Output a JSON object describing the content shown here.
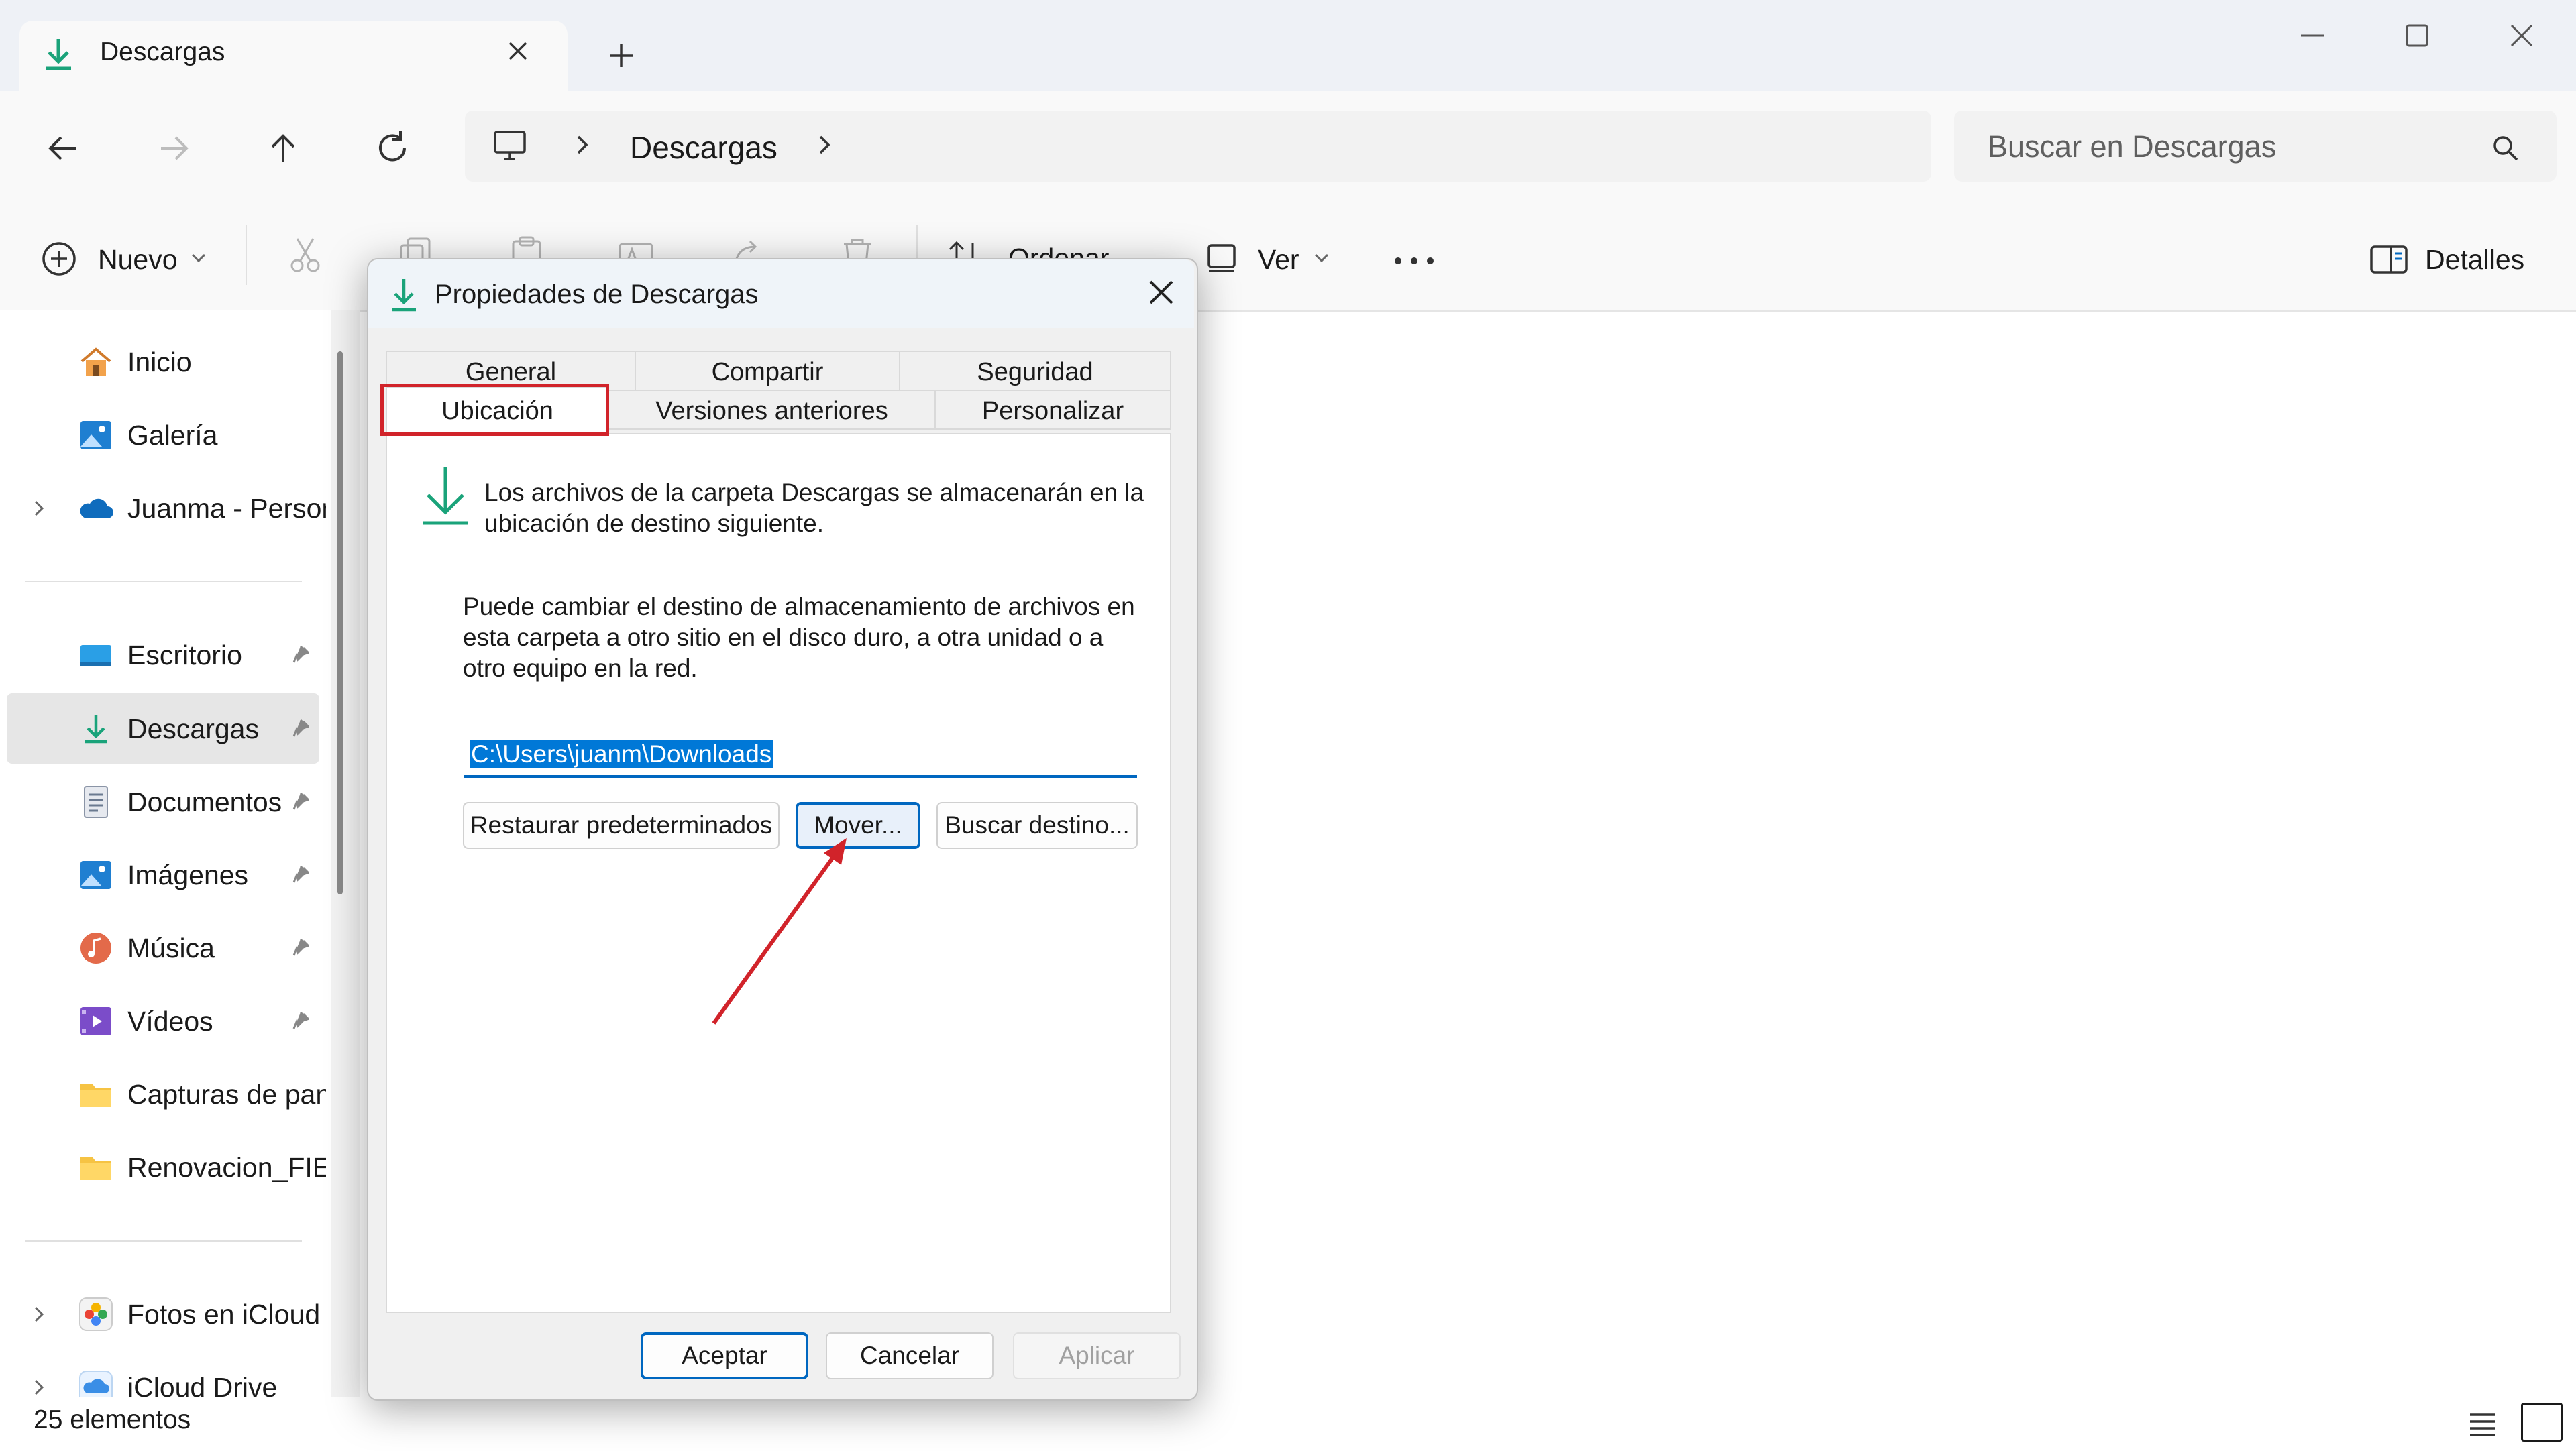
{
  "window": {
    "tab_title": "Descargas",
    "new_tab": "+"
  },
  "address": {
    "location": "Descargas",
    "search_placeholder": "Buscar en Descargas"
  },
  "commandbar": {
    "new_label": "Nuevo",
    "sort_label": "Ordenar",
    "view_label": "Ver",
    "details_label": "Detalles"
  },
  "nav": {
    "items": [
      {
        "label": "Inicio",
        "icon": "home-icon"
      },
      {
        "label": "Galería",
        "icon": "gallery-icon"
      },
      {
        "label": "Juanma - Personal",
        "icon": "onedrive-cloud-icon"
      },
      {
        "label": "Escritorio",
        "icon": "desktop-folder-icon"
      },
      {
        "label": "Descargas",
        "icon": "downloads-icon"
      },
      {
        "label": "Documentos",
        "icon": "documents-icon"
      },
      {
        "label": "Imágenes",
        "icon": "pictures-icon"
      },
      {
        "label": "Música",
        "icon": "music-icon"
      },
      {
        "label": "Vídeos",
        "icon": "videos-icon"
      },
      {
        "label": "Capturas de pantalla",
        "icon": "folder-icon"
      },
      {
        "label": "Renovacion_FIEL",
        "icon": "folder-icon"
      },
      {
        "label": "Fotos en iCloud",
        "icon": "icloud-photos-icon"
      },
      {
        "label": "iCloud Drive",
        "icon": "icloud-drive-icon"
      }
    ]
  },
  "status": {
    "count": "25 elementos"
  },
  "dialog": {
    "title": "Propiedades de Descargas",
    "tabs": {
      "general": "General",
      "compartir": "Compartir",
      "seguridad": "Seguridad",
      "ubicacion": "Ubicación",
      "versiones": "Versiones anteriores",
      "personalizar": "Personalizar"
    },
    "intro": "Los archivos de la carpeta Descargas se almacenarán en la ubicación de destino siguiente.",
    "description": "Puede cambiar el destino de almacenamiento de archivos en esta carpeta a otro sitio en el disco duro, a otra unidad o a otro equipo en la red.",
    "path": "C:\\Users\\juanm\\Downloads",
    "buttons": {
      "restore": "Restaurar predeterminados",
      "move": "Mover...",
      "browse": "Buscar destino...",
      "ok": "Aceptar",
      "cancel": "Cancelar",
      "apply": "Aplicar"
    }
  },
  "colors": {
    "accent": "#0067c0",
    "annotation_red": "#d1232a",
    "download_green": "#1aa37a"
  }
}
